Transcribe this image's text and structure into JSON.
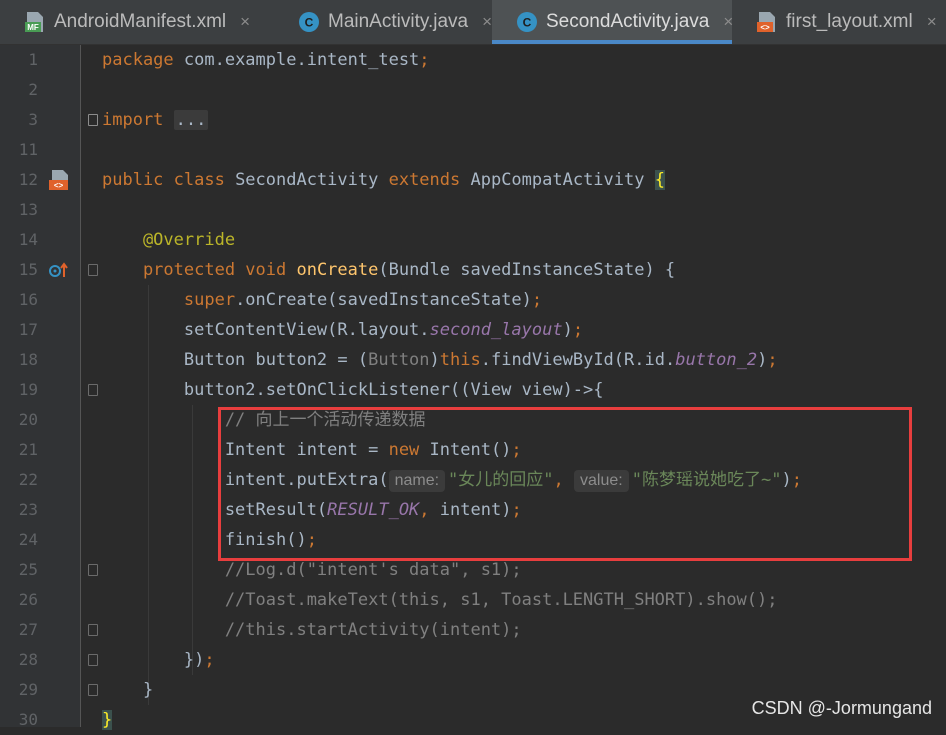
{
  "tabs": [
    {
      "label": "AndroidManifest.xml",
      "icon": "manifest-file-icon",
      "active": false
    },
    {
      "label": "MainActivity.java",
      "icon": "java-class-icon",
      "active": false
    },
    {
      "label": "SecondActivity.java",
      "icon": "java-class-icon",
      "active": true
    },
    {
      "label": "first_layout.xml",
      "icon": "layout-file-icon",
      "active": false
    }
  ],
  "tab_close_glyph": "×",
  "manifest_icon_text": "MF",
  "class_icon_text": "C",
  "layout_icon_text": "<>",
  "lines": [
    {
      "n": "1",
      "tokens": [
        {
          "t": "package ",
          "c": "kw"
        },
        {
          "t": "com.example.intent_test",
          "c": ""
        },
        {
          "t": ";",
          "c": "kw"
        }
      ]
    },
    {
      "n": "2",
      "tokens": []
    },
    {
      "n": "3",
      "tokens": [
        {
          "t": "import ",
          "c": "kw"
        },
        {
          "t": "...",
          "c": "fold-dots"
        }
      ]
    },
    {
      "n": "11",
      "tokens": []
    },
    {
      "n": "12",
      "tokens": [
        {
          "t": "public class ",
          "c": "kw"
        },
        {
          "t": "SecondActivity ",
          "c": ""
        },
        {
          "t": "extends ",
          "c": "kw"
        },
        {
          "t": "AppCompatActivity ",
          "c": ""
        },
        {
          "t": "{",
          "c": "brace-hl"
        }
      ]
    },
    {
      "n": "13",
      "tokens": []
    },
    {
      "n": "14",
      "tokens": [
        {
          "t": "    @Override",
          "c": "ann"
        }
      ]
    },
    {
      "n": "15",
      "tokens": [
        {
          "t": "    protected void ",
          "c": "kw"
        },
        {
          "t": "onCreate",
          "c": "fn"
        },
        {
          "t": "(Bundle savedInstanceState) {",
          "c": ""
        }
      ]
    },
    {
      "n": "16",
      "tokens": [
        {
          "t": "        super",
          "c": "kw"
        },
        {
          "t": ".onCreate(savedInstanceState)",
          "c": ""
        },
        {
          "t": ";",
          "c": "kw"
        }
      ]
    },
    {
      "n": "17",
      "tokens": [
        {
          "t": "        setContentView(R.layout.",
          "c": ""
        },
        {
          "t": "second_layout",
          "c": "ital"
        },
        {
          "t": ")",
          "c": ""
        },
        {
          "t": ";",
          "c": "kw"
        }
      ]
    },
    {
      "n": "18",
      "tokens": [
        {
          "t": "        Button button2 = (",
          "c": ""
        },
        {
          "t": "Button",
          "c": "cmt"
        },
        {
          "t": ")",
          "c": ""
        },
        {
          "t": "this",
          "c": "kw"
        },
        {
          "t": ".findViewById(R.id.",
          "c": ""
        },
        {
          "t": "button_2",
          "c": "ital"
        },
        {
          "t": ")",
          "c": ""
        },
        {
          "t": ";",
          "c": "kw"
        }
      ]
    },
    {
      "n": "19",
      "tokens": [
        {
          "t": "        button2.setOnClickListener((View view)->{",
          "c": ""
        }
      ]
    },
    {
      "n": "20",
      "tokens": [
        {
          "t": "            // 向上一个活动传递数据",
          "c": "cmt"
        }
      ]
    },
    {
      "n": "21",
      "tokens": [
        {
          "t": "            Intent intent = ",
          "c": ""
        },
        {
          "t": "new ",
          "c": "kw"
        },
        {
          "t": "Intent()",
          "c": ""
        },
        {
          "t": ";",
          "c": "kw"
        }
      ]
    },
    {
      "n": "22",
      "tokens": [
        {
          "t": "            intent.putExtra(",
          "c": ""
        },
        {
          "t": "name:",
          "c": "hint"
        },
        {
          "t": "\"女儿的回应\"",
          "c": "str"
        },
        {
          "t": ", ",
          "c": "kw"
        },
        {
          "t": "value:",
          "c": "hint"
        },
        {
          "t": "\"陈梦瑶说她吃了~\"",
          "c": "str"
        },
        {
          "t": ")",
          "c": ""
        },
        {
          "t": ";",
          "c": "kw"
        }
      ]
    },
    {
      "n": "23",
      "tokens": [
        {
          "t": "            setResult(",
          "c": ""
        },
        {
          "t": "RESULT_OK",
          "c": "ital"
        },
        {
          "t": ", ",
          "c": "kw"
        },
        {
          "t": "intent)",
          "c": ""
        },
        {
          "t": ";",
          "c": "kw"
        }
      ]
    },
    {
      "n": "24",
      "tokens": [
        {
          "t": "            finish()",
          "c": ""
        },
        {
          "t": ";",
          "c": "kw"
        }
      ]
    },
    {
      "n": "25",
      "tokens": [
        {
          "t": "            //Log.d(\"intent's data\", s1);",
          "c": "cmt"
        }
      ]
    },
    {
      "n": "26",
      "tokens": [
        {
          "t": "            //Toast.makeText(this, s1, Toast.LENGTH_SHORT).show();",
          "c": "cmt"
        }
      ]
    },
    {
      "n": "27",
      "tokens": [
        {
          "t": "            //this.startActivity(intent);",
          "c": "cmt"
        }
      ]
    },
    {
      "n": "28",
      "tokens": [
        {
          "t": "        })",
          "c": ""
        },
        {
          "t": ";",
          "c": "kw"
        }
      ]
    },
    {
      "n": "29",
      "tokens": [
        {
          "t": "    }",
          "c": ""
        }
      ]
    },
    {
      "n": "30",
      "tokens": [
        {
          "t": "}",
          "c": "brace-hl"
        }
      ]
    }
  ],
  "watermark": "CSDN @-Jormungand",
  "colors": {
    "accent": "#4a88c7",
    "highlight_box": "#e83e3e",
    "keyword": "#cc7832",
    "string": "#6a8759",
    "method": "#ffc66d"
  }
}
